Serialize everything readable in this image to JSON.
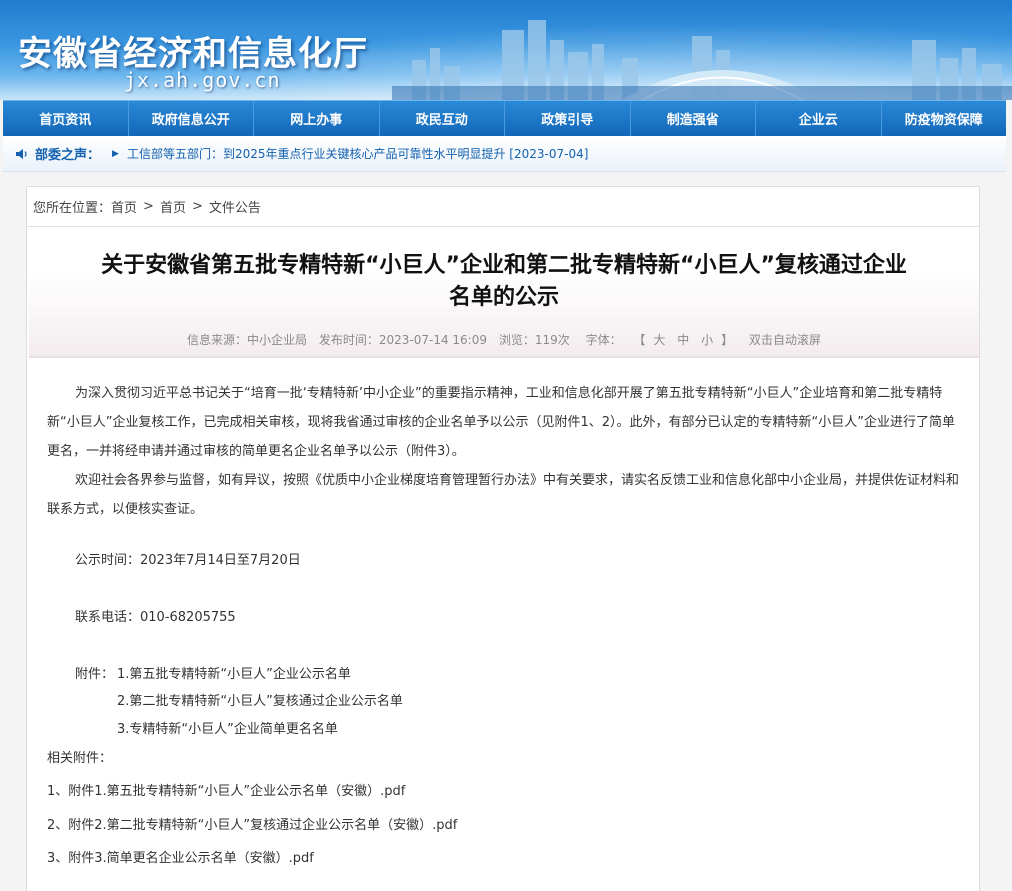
{
  "header": {
    "site_title": "安徽省经济和信息化厅",
    "site_domain": "jx.ah.gov.cn"
  },
  "nav": {
    "items": [
      "首页资讯",
      "政府信息公开",
      "网上办事",
      "政民互动",
      "政策引导",
      "制造强省",
      "企业云",
      "防疫物资保障"
    ]
  },
  "ticker": {
    "label": "部委之声：",
    "text": "工信部等五部门：到2025年重点行业关键核心产品可靠性水平明显提升 [2023-07-04]"
  },
  "breadcrumb": {
    "prefix": "您所在位置：",
    "items": [
      "首页",
      "首页",
      "文件公告"
    ]
  },
  "article": {
    "title_line1": "关于安徽省第五批专精特新“小巨人”企业和第二批专精特新“小巨人”复核通过企业",
    "title_line2": "名单的公示",
    "meta": {
      "source": "信息来源：中小企业局",
      "date": "发布时间：2023-07-14 16:09",
      "views": "浏览：119次",
      "font_label": "字体：",
      "font_bracket_open": "【",
      "font_large": "大",
      "font_medium": "中",
      "font_small": "小",
      "font_bracket_close": "】",
      "autoscroll": "双击自动滚屏"
    },
    "paragraph1": "为深入贯彻习近平总书记关于“培育一批‘专精特新’中小企业”的重要指示精神，工业和信息化部开展了第五批专精特新“小巨人”企业培育和第二批专精特新“小巨人”企业复核工作，已完成相关审核，现将我省通过审核的企业名单予以公示（见附件1、2）。此外，有部分已认定的专精特新“小巨人”企业进行了简单更名，一并将经申请并通过审核的简单更名企业名单予以公示（附件3）。",
    "paragraph2": "欢迎社会各界参与监督，如有异议，按照《优质中小企业梯度培育管理暂行办法》中有关要求，请实名反馈工业和信息化部中小企业局，并提供佐证材料和联系方式，以便核实查证。",
    "period": "公示时间：2023年7月14日至7月20日",
    "phone": "联系电话：010-68205755",
    "attachments_prefix": "附件：",
    "attachments": [
      "1.第五批专精特新“小巨人”企业公示名单",
      "2.第二批专精特新“小巨人”复核通过企业公示名单",
      "3.专精特新“小巨人”企业简单更名名单"
    ],
    "related_label": "相关附件：",
    "related_files": [
      "1、附件1.第五批专精特新“小巨人”企业公示名单（安徽）.pdf",
      "2、附件2.第二批专精特新“小巨人”复核通过企业公示名单（安徽）.pdf",
      "3、附件3.简单更名企业公示名单（安徽）.pdf"
    ]
  }
}
